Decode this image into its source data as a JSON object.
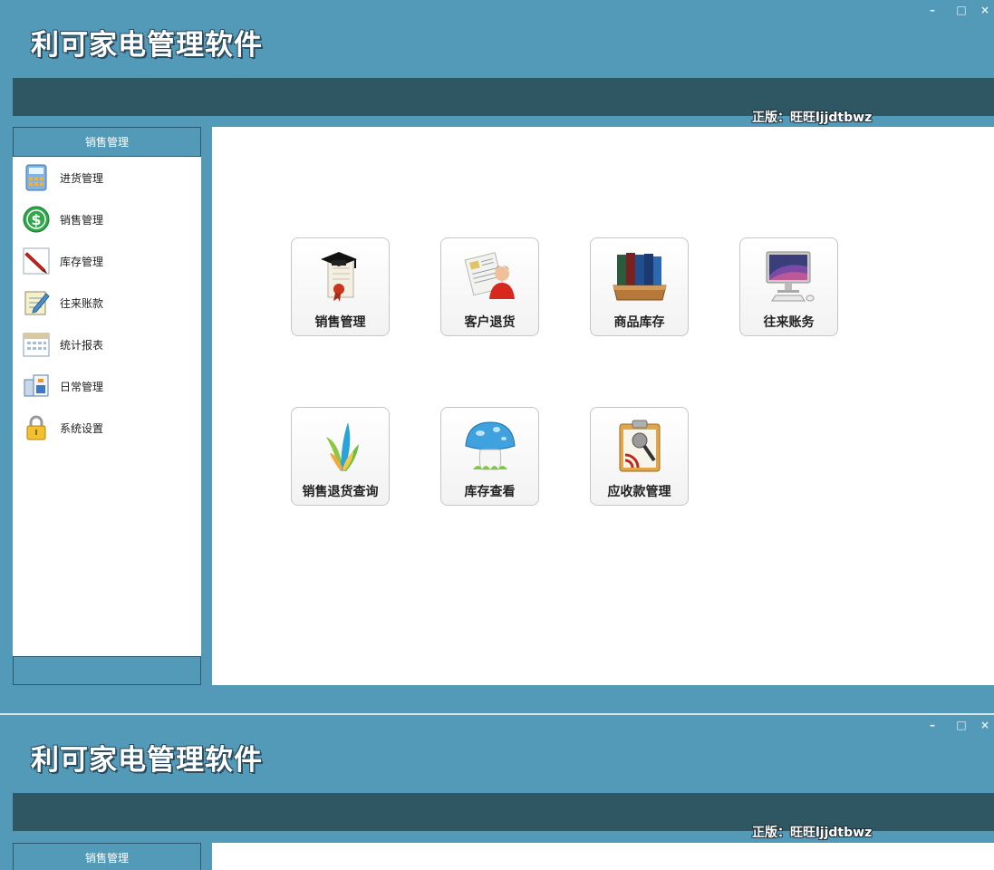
{
  "window": {
    "title": "利可家电管理软件",
    "license": "正版：旺旺ljjdtbwz",
    "controls": {
      "minimize": "–",
      "maximize": "□",
      "close": "×"
    }
  },
  "sidebar": {
    "header": "销售管理",
    "items": [
      {
        "label": "进货管理",
        "icon": "calculator-icon"
      },
      {
        "label": "销售管理",
        "icon": "dollar-icon"
      },
      {
        "label": "库存管理",
        "icon": "pencil-icon"
      },
      {
        "label": "往来账款",
        "icon": "notepad-icon"
      },
      {
        "label": "统计报表",
        "icon": "calendar-icon"
      },
      {
        "label": "日常管理",
        "icon": "office-icon"
      },
      {
        "label": "系统设置",
        "icon": "lock-icon"
      }
    ]
  },
  "tiles": [
    {
      "label": "销售管理",
      "icon": "diploma-icon"
    },
    {
      "label": "客户退货",
      "icon": "customer-icon"
    },
    {
      "label": "商品库存",
      "icon": "books-icon"
    },
    {
      "label": "往来账务",
      "icon": "computer-icon"
    },
    {
      "label": "销售退货查询",
      "icon": "plant-icon"
    },
    {
      "label": "库存查看",
      "icon": "mushroom-icon"
    },
    {
      "label": "应收款管理",
      "icon": "clipboard-icon"
    }
  ],
  "second_window": {
    "title": "利可家电管理软件",
    "license": "正版：旺旺ljjdtbwz",
    "sidebar_header": "销售管理"
  },
  "colors": {
    "frame": "#5399b8",
    "topbar": "#2f5763",
    "border": "#2c5970"
  }
}
